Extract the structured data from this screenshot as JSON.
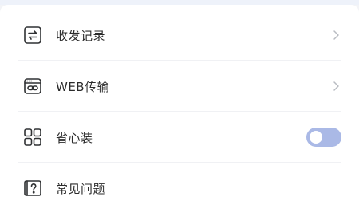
{
  "menu": {
    "items": [
      {
        "label": "收发记录",
        "icon": "transfer-arrows-icon",
        "control": "chevron"
      },
      {
        "label": "WEB传输",
        "icon": "web-transfer-icon",
        "control": "chevron"
      },
      {
        "label": "省心装",
        "icon": "grid-apps-icon",
        "control": "toggle",
        "toggle_on": false
      },
      {
        "label": "常见问题",
        "icon": "help-question-icon",
        "control": "none"
      }
    ]
  },
  "colors": {
    "text": "#2b2b2b",
    "icon": "#2f3133",
    "chevron": "#b9bcc2",
    "toggle_track": "#aab9e6",
    "toggle_knob": "#ffffff",
    "divider": "#f0f1f4"
  }
}
